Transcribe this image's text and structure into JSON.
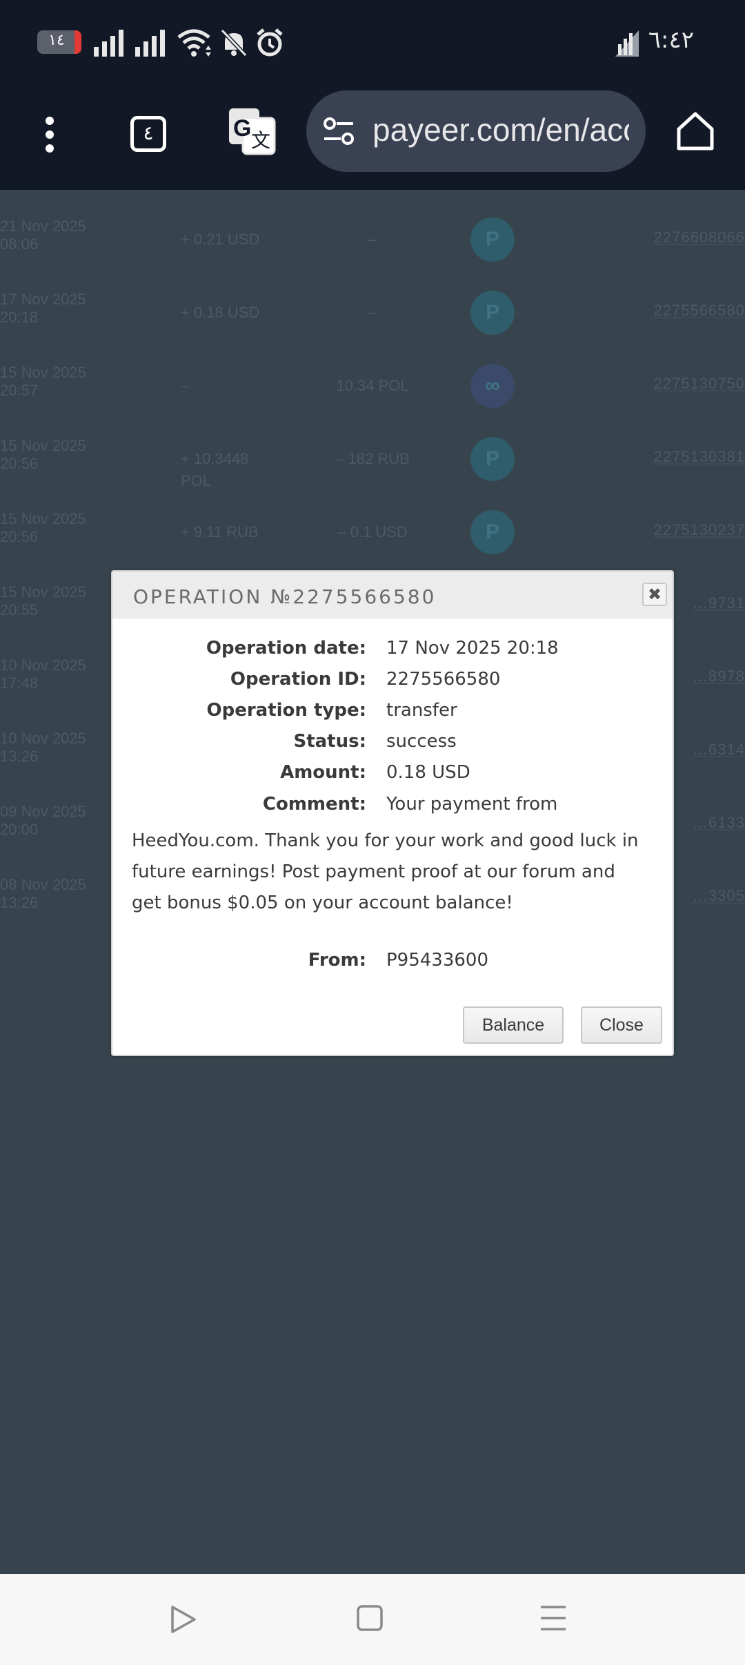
{
  "status_bar": {
    "battery_level": "١٤",
    "time": "٦:٤٢",
    "icons": [
      "signal-icon",
      "signal-icon",
      "wifi-icon",
      "bell-off-icon",
      "alarm-icon",
      "network-icon"
    ]
  },
  "browser": {
    "url": "payeer.com/en/account/history",
    "tab_count": "٤",
    "icons": [
      "more-vert-icon",
      "tabs-icon",
      "translate-icon",
      "site-settings-icon",
      "home-icon"
    ]
  },
  "background_rows": [
    {
      "date_line1": "21 Nov 2025",
      "date_line2": "08:06",
      "amount": "+ 0.21 USD",
      "fee": "–",
      "logo": "P",
      "op_id": "2276608066"
    },
    {
      "date_line1": "17 Nov 2025",
      "date_line2": "20:18",
      "amount": "+ 0.18 USD",
      "fee": "–",
      "logo": "P",
      "op_id": "2275566580"
    },
    {
      "date_line1": "15 Nov 2025",
      "date_line2": "20:57",
      "amount": "–",
      "fee": "10.34 POL",
      "logo": "∞",
      "op_id": "2275130750"
    },
    {
      "date_line1": "15 Nov 2025",
      "date_line2": "20:56",
      "amount": "+ 10.3448 POL",
      "fee": "– 182 RUB",
      "logo": "P",
      "op_id": "2275130381"
    },
    {
      "date_line1": "15 Nov 2025",
      "date_line2": "20:56",
      "amount": "+ 9.11 RUB",
      "fee": "– 0.1 USD",
      "logo": "P",
      "op_id": "2275130237"
    },
    {
      "date_line1": "15 Nov 2025",
      "date_line2": "20:55",
      "amount": "",
      "fee": "",
      "logo": "",
      "op_id": "…9731"
    },
    {
      "date_line1": "10 Nov 2025",
      "date_line2": "17:48",
      "amount": "",
      "fee": "",
      "logo": "",
      "op_id": "…8978"
    },
    {
      "date_line1": "10 Nov 2025",
      "date_line2": "13:26",
      "amount": "",
      "fee": "",
      "logo": "",
      "op_id": "…6314"
    },
    {
      "date_line1": "09 Nov 2025",
      "date_line2": "20:00",
      "amount": "",
      "fee": "",
      "logo": "",
      "op_id": "…6133"
    },
    {
      "date_line1": "08 Nov 2025",
      "date_line2": "13:26",
      "amount": "",
      "fee": "",
      "logo": "",
      "op_id": "…3305"
    }
  ],
  "modal": {
    "title": "OPERATION №2275566580",
    "close_icon": "close-icon",
    "operation_date_label": "Operation date:",
    "operation_date_value": "17 Nov 2025 20:18",
    "operation_id_label": "Operation ID:",
    "operation_id_value": "2275566580",
    "operation_type_label": "Operation type:",
    "operation_type_value": "transfer",
    "status_label": "Status:",
    "status_value": "success",
    "amount_label": "Amount:",
    "amount_value": "0.18 USD",
    "comment_label": "Comment:",
    "comment_first_line": "Your payment from",
    "comment_rest": "HeedYou.com. Thank you for your work and good luck in future earnings! Post payment proof at our forum and get bonus $0.05 on your account balance!",
    "from_label": "From:",
    "from_value": "P95433600",
    "balance_button": "Balance",
    "close_button": "Close"
  },
  "nav": {
    "icons": [
      "back-icon",
      "home-square-icon",
      "recents-icon"
    ]
  }
}
